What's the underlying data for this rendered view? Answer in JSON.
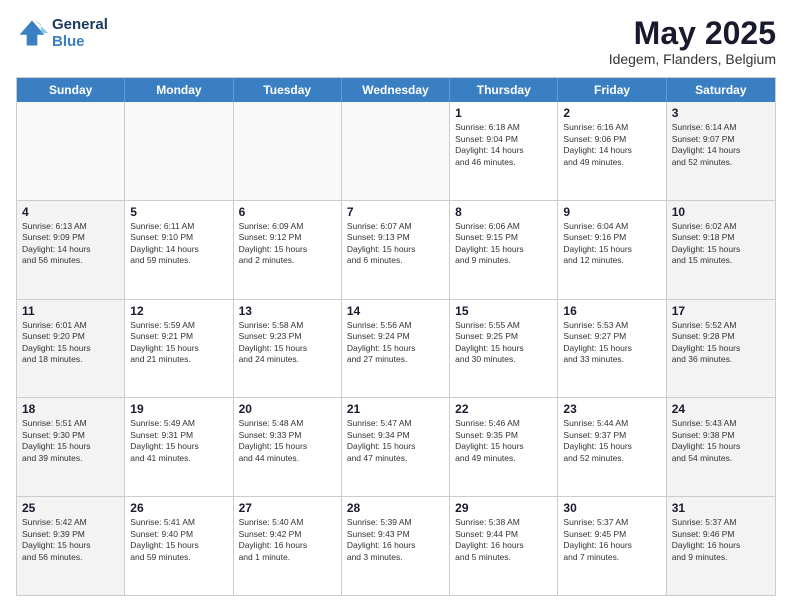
{
  "logo": {
    "line1": "General",
    "line2": "Blue"
  },
  "title": "May 2025",
  "subtitle": "Idegem, Flanders, Belgium",
  "header_days": [
    "Sunday",
    "Monday",
    "Tuesday",
    "Wednesday",
    "Thursday",
    "Friday",
    "Saturday"
  ],
  "rows": [
    [
      {
        "day": "",
        "text": ""
      },
      {
        "day": "",
        "text": ""
      },
      {
        "day": "",
        "text": ""
      },
      {
        "day": "",
        "text": ""
      },
      {
        "day": "1",
        "text": "Sunrise: 6:18 AM\nSunset: 9:04 PM\nDaylight: 14 hours\nand 46 minutes."
      },
      {
        "day": "2",
        "text": "Sunrise: 6:16 AM\nSunset: 9:06 PM\nDaylight: 14 hours\nand 49 minutes."
      },
      {
        "day": "3",
        "text": "Sunrise: 6:14 AM\nSunset: 9:07 PM\nDaylight: 14 hours\nand 52 minutes."
      }
    ],
    [
      {
        "day": "4",
        "text": "Sunrise: 6:13 AM\nSunset: 9:09 PM\nDaylight: 14 hours\nand 56 minutes."
      },
      {
        "day": "5",
        "text": "Sunrise: 6:11 AM\nSunset: 9:10 PM\nDaylight: 14 hours\nand 59 minutes."
      },
      {
        "day": "6",
        "text": "Sunrise: 6:09 AM\nSunset: 9:12 PM\nDaylight: 15 hours\nand 2 minutes."
      },
      {
        "day": "7",
        "text": "Sunrise: 6:07 AM\nSunset: 9:13 PM\nDaylight: 15 hours\nand 6 minutes."
      },
      {
        "day": "8",
        "text": "Sunrise: 6:06 AM\nSunset: 9:15 PM\nDaylight: 15 hours\nand 9 minutes."
      },
      {
        "day": "9",
        "text": "Sunrise: 6:04 AM\nSunset: 9:16 PM\nDaylight: 15 hours\nand 12 minutes."
      },
      {
        "day": "10",
        "text": "Sunrise: 6:02 AM\nSunset: 9:18 PM\nDaylight: 15 hours\nand 15 minutes."
      }
    ],
    [
      {
        "day": "11",
        "text": "Sunrise: 6:01 AM\nSunset: 9:20 PM\nDaylight: 15 hours\nand 18 minutes."
      },
      {
        "day": "12",
        "text": "Sunrise: 5:59 AM\nSunset: 9:21 PM\nDaylight: 15 hours\nand 21 minutes."
      },
      {
        "day": "13",
        "text": "Sunrise: 5:58 AM\nSunset: 9:23 PM\nDaylight: 15 hours\nand 24 minutes."
      },
      {
        "day": "14",
        "text": "Sunrise: 5:56 AM\nSunset: 9:24 PM\nDaylight: 15 hours\nand 27 minutes."
      },
      {
        "day": "15",
        "text": "Sunrise: 5:55 AM\nSunset: 9:25 PM\nDaylight: 15 hours\nand 30 minutes."
      },
      {
        "day": "16",
        "text": "Sunrise: 5:53 AM\nSunset: 9:27 PM\nDaylight: 15 hours\nand 33 minutes."
      },
      {
        "day": "17",
        "text": "Sunrise: 5:52 AM\nSunset: 9:28 PM\nDaylight: 15 hours\nand 36 minutes."
      }
    ],
    [
      {
        "day": "18",
        "text": "Sunrise: 5:51 AM\nSunset: 9:30 PM\nDaylight: 15 hours\nand 39 minutes."
      },
      {
        "day": "19",
        "text": "Sunrise: 5:49 AM\nSunset: 9:31 PM\nDaylight: 15 hours\nand 41 minutes."
      },
      {
        "day": "20",
        "text": "Sunrise: 5:48 AM\nSunset: 9:33 PM\nDaylight: 15 hours\nand 44 minutes."
      },
      {
        "day": "21",
        "text": "Sunrise: 5:47 AM\nSunset: 9:34 PM\nDaylight: 15 hours\nand 47 minutes."
      },
      {
        "day": "22",
        "text": "Sunrise: 5:46 AM\nSunset: 9:35 PM\nDaylight: 15 hours\nand 49 minutes."
      },
      {
        "day": "23",
        "text": "Sunrise: 5:44 AM\nSunset: 9:37 PM\nDaylight: 15 hours\nand 52 minutes."
      },
      {
        "day": "24",
        "text": "Sunrise: 5:43 AM\nSunset: 9:38 PM\nDaylight: 15 hours\nand 54 minutes."
      }
    ],
    [
      {
        "day": "25",
        "text": "Sunrise: 5:42 AM\nSunset: 9:39 PM\nDaylight: 15 hours\nand 56 minutes."
      },
      {
        "day": "26",
        "text": "Sunrise: 5:41 AM\nSunset: 9:40 PM\nDaylight: 15 hours\nand 59 minutes."
      },
      {
        "day": "27",
        "text": "Sunrise: 5:40 AM\nSunset: 9:42 PM\nDaylight: 16 hours\nand 1 minute."
      },
      {
        "day": "28",
        "text": "Sunrise: 5:39 AM\nSunset: 9:43 PM\nDaylight: 16 hours\nand 3 minutes."
      },
      {
        "day": "29",
        "text": "Sunrise: 5:38 AM\nSunset: 9:44 PM\nDaylight: 16 hours\nand 5 minutes."
      },
      {
        "day": "30",
        "text": "Sunrise: 5:37 AM\nSunset: 9:45 PM\nDaylight: 16 hours\nand 7 minutes."
      },
      {
        "day": "31",
        "text": "Sunrise: 5:37 AM\nSunset: 9:46 PM\nDaylight: 16 hours\nand 9 minutes."
      }
    ]
  ]
}
